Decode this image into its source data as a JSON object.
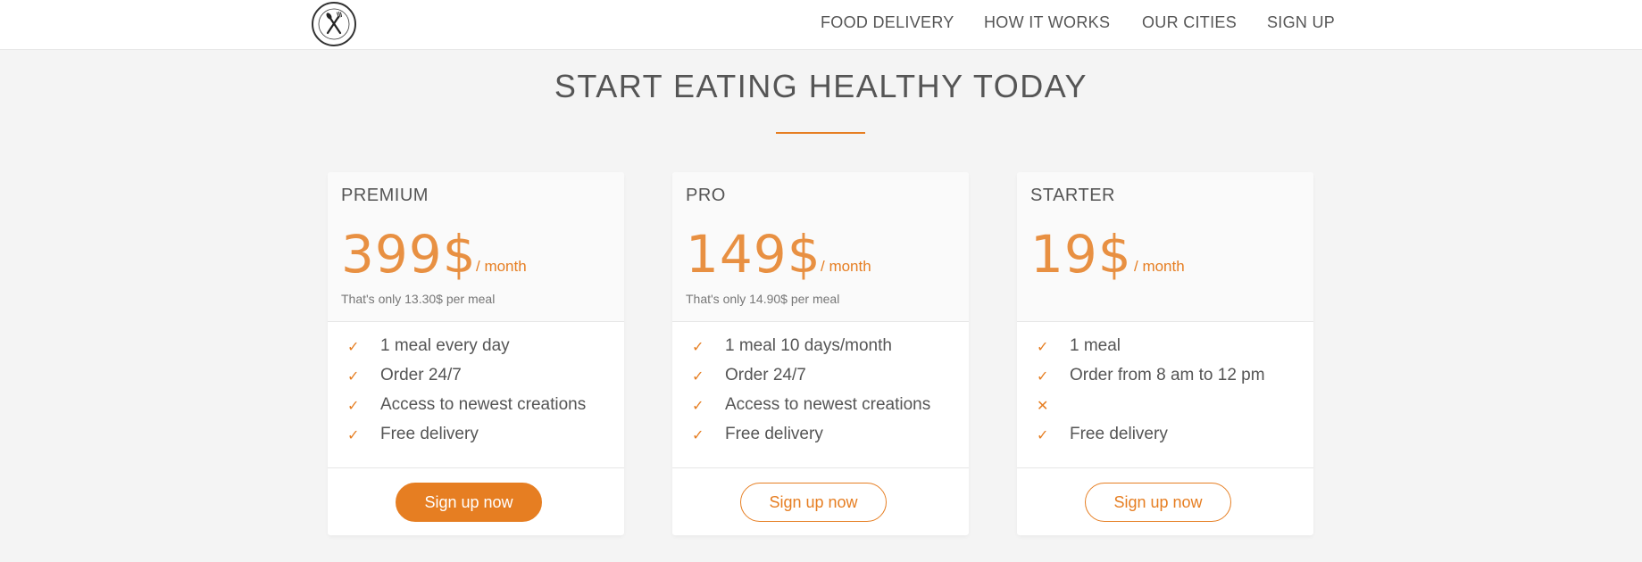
{
  "nav": {
    "logo_icon": "fork-knife-logo-icon",
    "links": [
      "FOOD DELIVERY",
      "HOW IT WORKS",
      "OUR CITIES",
      "SIGN UP"
    ]
  },
  "section": {
    "title": "START EATING HEALTHY TODAY",
    "accent_color": "#e67e22"
  },
  "plans": [
    {
      "name": "PREMIUM",
      "price": "399$",
      "period": "/ month",
      "note": "That's only 13.30$ per meal",
      "features": [
        {
          "icon": "check-icon",
          "text": "1 meal every day"
        },
        {
          "icon": "check-icon",
          "text": "Order 24/7"
        },
        {
          "icon": "check-icon",
          "text": "Access to newest creations"
        },
        {
          "icon": "check-icon",
          "text": "Free delivery"
        }
      ],
      "button": "Sign up now",
      "button_style": "filled"
    },
    {
      "name": "PRO",
      "price": "149$",
      "period": "/ month",
      "note": "That's only 14.90$ per meal",
      "features": [
        {
          "icon": "check-icon",
          "text": "1 meal 10 days/month"
        },
        {
          "icon": "check-icon",
          "text": "Order 24/7"
        },
        {
          "icon": "check-icon",
          "text": "Access to newest creations"
        },
        {
          "icon": "check-icon",
          "text": "Free delivery"
        }
      ],
      "button": "Sign up now",
      "button_style": "outline"
    },
    {
      "name": "STARTER",
      "price": "19$",
      "period": "/ month",
      "note": "",
      "features": [
        {
          "icon": "check-icon",
          "text": "1 meal"
        },
        {
          "icon": "check-icon",
          "text": "Order from 8 am to 12 pm"
        },
        {
          "icon": "cross-icon",
          "text": ""
        },
        {
          "icon": "check-icon",
          "text": "Free delivery"
        }
      ],
      "button": "Sign up now",
      "button_style": "outline"
    }
  ]
}
